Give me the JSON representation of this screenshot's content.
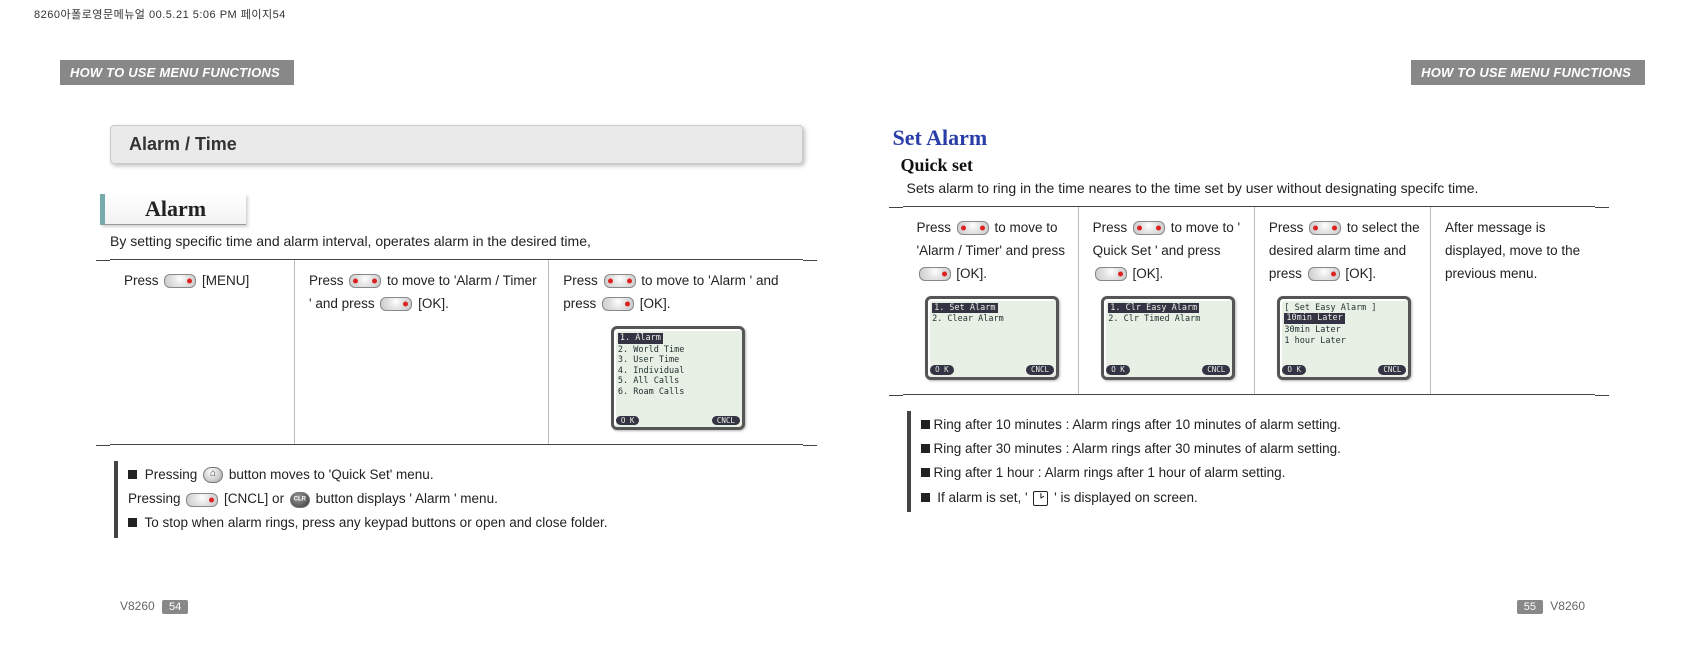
{
  "crop_mark": "8260아폴로영문메뉴얼   00.5.21 5:06 PM  페이지54",
  "left": {
    "banner": "HOW TO USE MENU FUNCTIONS",
    "title_bar": "Alarm / Time",
    "box_title": "Alarm",
    "intro": "By setting specific time and alarm interval, operates alarm in the desired time,",
    "steps": {
      "c1_a": "Press ",
      "c1_b": " [MENU]",
      "c2_a": "Press ",
      "c2_b": " to move to  'Alarm / Timer '  and press ",
      "c2_c": " [OK].",
      "c3_a": "Press ",
      "c3_b": " to move to  'Alarm ' and press ",
      "c3_c": " [OK]."
    },
    "screen": {
      "lines": [
        "1. Alarm",
        "2. World Time",
        "3. User Time",
        "4. Individual",
        "5. All Calls",
        "6. Roam Calls"
      ],
      "sk_left": "O K",
      "sk_right": "CNCL"
    },
    "notes": {
      "n1_a": "Pressing  ",
      "n1_b": " button moves to  'Quick Set'  menu.",
      "n2_a": " Pressing ",
      "n2_b": " [CNCL] or  ",
      "n2_c": " button displays  ' Alarm '  menu.",
      "n3": "To stop when alarm rings, press any keypad buttons or open and close folder."
    },
    "model": "V8260",
    "page_num": "54"
  },
  "right": {
    "banner": "HOW TO USE MENU FUNCTIONS",
    "blue_h1": "Set Alarm",
    "blue_h2": "Quick set",
    "intro": "Sets alarm to  ring in  the time  neares to the  time set  by user  without designating specifc time.",
    "steps": {
      "c1_a": "Press ",
      "c1_b": " to move to 'Alarm / Timer'  and press ",
      "c1_c": " [OK].",
      "c2_a": "Press ",
      "c2_b": " to move to ' Quick Set '  and press ",
      "c2_c": " [OK].",
      "c3_a": "Press ",
      "c3_b": " to select the desired alarm time and press ",
      "c3_c": " [OK].",
      "c4": "After message is displayed, move to the previous menu."
    },
    "screen1": {
      "lines": [
        "1. Set Alarm",
        "2. Clear Alarm"
      ],
      "sk_left": "O K",
      "sk_right": "CNCL"
    },
    "screen2": {
      "lines": [
        "1. Clr Easy Alarm",
        "2. Clr Timed Alarm"
      ],
      "sk_left": "O K",
      "sk_right": "CNCL"
    },
    "screen3": {
      "title": "[ Set Easy Alarm ]",
      "lines": [
        "10min Later",
        "30min Later",
        "1  hour Later"
      ],
      "sk_left": "O K",
      "sk_right": "CNCL"
    },
    "notes": {
      "n1": "Ring after 10 minutes : Alarm rings after 10 minutes of alarm setting.",
      "n2": "Ring after 30 minutes : Alarm rings after 30 minutes of alarm setting.",
      "n3": "Ring after 1 hour : Alarm rings after 1 hour of alarm setting.",
      "n4_a": "If alarm is set, ' ",
      "n4_b": " ' is displayed on screen."
    },
    "model": "V8260",
    "page_num": "55"
  }
}
